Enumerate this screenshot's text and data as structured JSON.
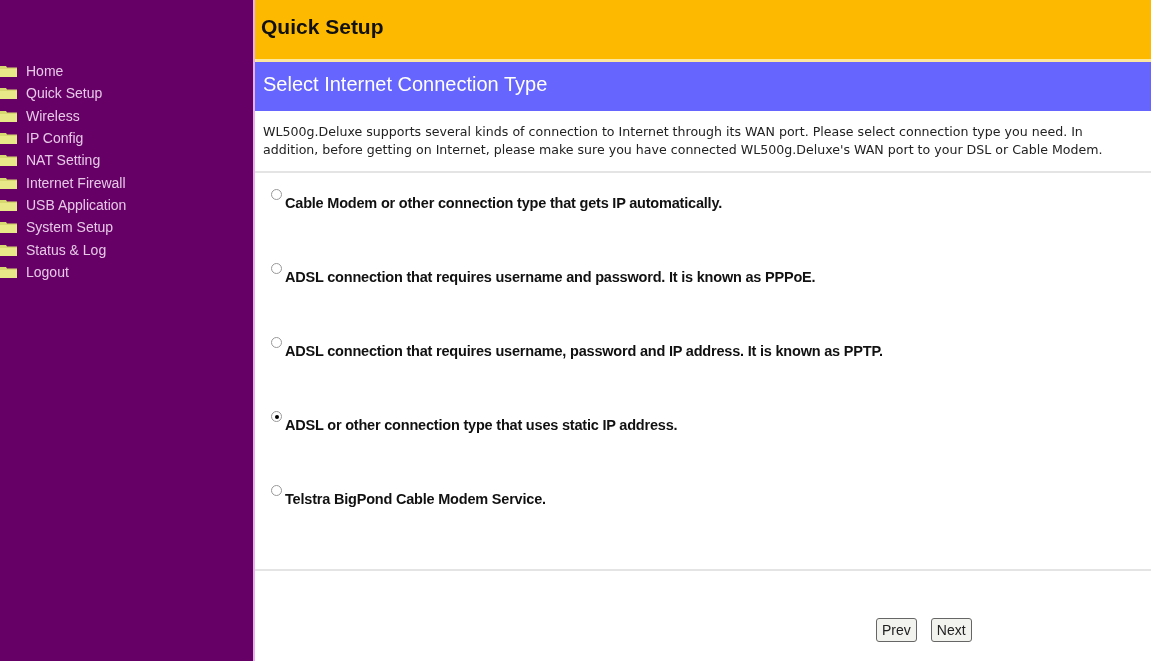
{
  "sidebar": {
    "items": [
      {
        "label": "Home"
      },
      {
        "label": "Quick Setup"
      },
      {
        "label": "Wireless"
      },
      {
        "label": "IP Config"
      },
      {
        "label": "NAT Setting"
      },
      {
        "label": "Internet Firewall"
      },
      {
        "label": "USB Application"
      },
      {
        "label": "System Setup"
      },
      {
        "label": "Status & Log"
      },
      {
        "label": "Logout"
      }
    ]
  },
  "page_title": "Quick Setup",
  "section_title": "Select Internet Connection Type",
  "description": "WL500g.Deluxe supports several kinds of connection to Internet through its WAN port. Please select connection type you need. In addition, before getting on Internet, please make sure you have connected WL500g.Deluxe's WAN port to your DSL or Cable Modem.",
  "options": [
    {
      "label": "Cable Modem or other connection type that gets IP automatically.",
      "selected": false
    },
    {
      "label": "ADSL connection that requires username and password. It is known as PPPoE.",
      "selected": false
    },
    {
      "label": "ADSL connection that requires username, password and IP address. It is known as PPTP.",
      "selected": false
    },
    {
      "label": "ADSL or other connection type that uses static IP address.",
      "selected": true
    },
    {
      "label": "Telstra BigPond Cable Modem Service.",
      "selected": false
    }
  ],
  "buttons": [
    "Prev",
    "Next"
  ]
}
